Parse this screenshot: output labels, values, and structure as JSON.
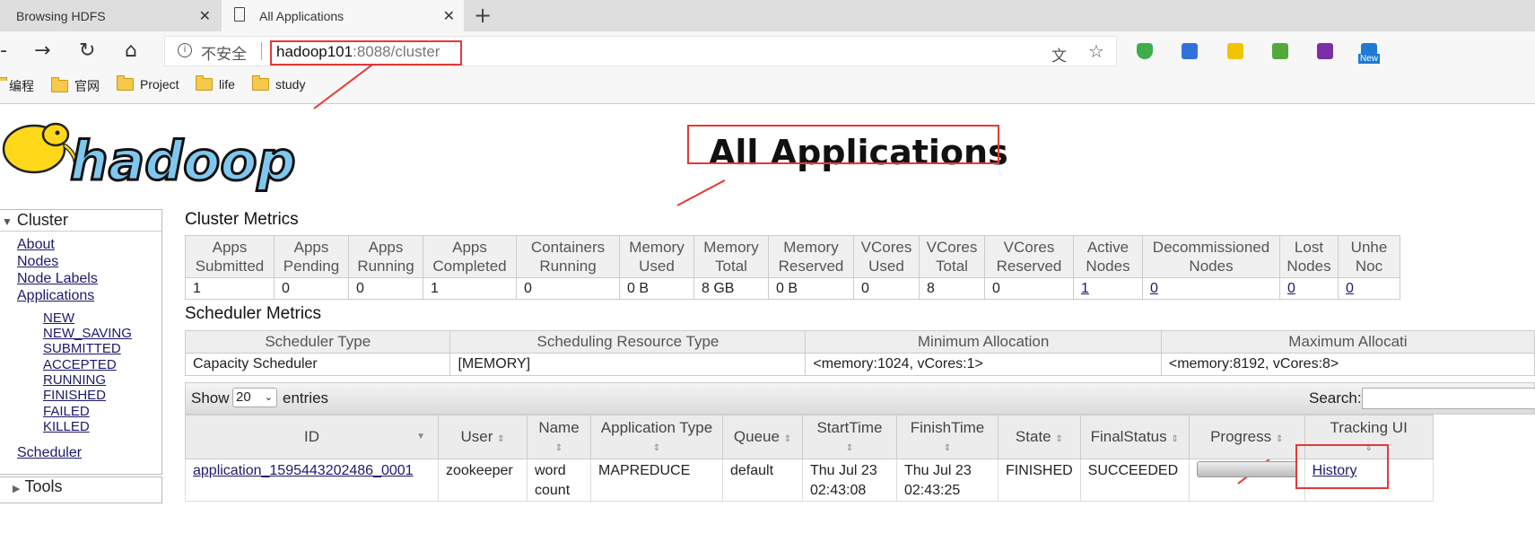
{
  "browser": {
    "tabs": [
      {
        "label": "Browsing HDFS",
        "active": false
      },
      {
        "label": "All Applications",
        "active": true
      }
    ],
    "address": {
      "security": "不安全",
      "host": "hadoop101",
      "path": ":8088/cluster"
    },
    "bookmarks": [
      "编程",
      "官网",
      "Project",
      "life",
      "study"
    ],
    "extension_badge": "New"
  },
  "page": {
    "title": "All Applications",
    "logo_text": "hadoop"
  },
  "sidebar": {
    "cluster_label": "Cluster",
    "links": [
      "About",
      "Nodes",
      "Node Labels",
      "Applications"
    ],
    "app_states": [
      "NEW",
      "NEW_SAVING",
      "SUBMITTED",
      "ACCEPTED",
      "RUNNING",
      "FINISHED",
      "FAILED",
      "KILLED"
    ],
    "scheduler": "Scheduler",
    "tools": "Tools"
  },
  "cluster_metrics": {
    "title": "Cluster Metrics",
    "headers": [
      [
        "Apps",
        "Submitted"
      ],
      [
        "Apps",
        "Pending"
      ],
      [
        "Apps",
        "Running"
      ],
      [
        "Apps",
        "Completed"
      ],
      [
        "Containers",
        "Running"
      ],
      [
        "Memory",
        "Used"
      ],
      [
        "Memory",
        "Total"
      ],
      [
        "Memory",
        "Reserved"
      ],
      [
        "VCores",
        "Used"
      ],
      [
        "VCores",
        "Total"
      ],
      [
        "VCores",
        "Reserved"
      ],
      [
        "Active",
        "Nodes"
      ],
      [
        "Decommissioned",
        "Nodes"
      ],
      [
        "Lost",
        "Nodes"
      ],
      [
        "Unhe",
        "Noc"
      ]
    ],
    "values": [
      "1",
      "0",
      "0",
      "1",
      "0",
      "0 B",
      "8 GB",
      "0 B",
      "0",
      "8",
      "0",
      "1",
      "0",
      "0",
      "0"
    ]
  },
  "scheduler_metrics": {
    "title": "Scheduler Metrics",
    "headers": [
      "Scheduler Type",
      "Scheduling Resource Type",
      "Minimum Allocation",
      "Maximum Allocati"
    ],
    "values": [
      "Capacity Scheduler",
      "[MEMORY]",
      "<memory:1024, vCores:1>",
      "<memory:8192, vCores:8>"
    ]
  },
  "apps_table": {
    "show_label": "Show",
    "page_size": "20",
    "entries_label": "entries",
    "search_label": "Search:",
    "headers": [
      "ID",
      "User",
      "Name",
      "Application Type",
      "Queue",
      "StartTime",
      "FinishTime",
      "State",
      "FinalStatus",
      "Progress",
      "Tracking UI"
    ],
    "row": {
      "id": "application_1595443202486_0001",
      "user": "zookeeper",
      "name": "word count",
      "type": "MAPREDUCE",
      "queue": "default",
      "start": "Thu Jul 23 02:43:08",
      "finish": "Thu Jul 23 02:43:25",
      "state": "FINISHED",
      "final_status": "SUCCEEDED",
      "progress": 1.0,
      "tracking": "History"
    }
  },
  "colors": {
    "annotation": "#e53935",
    "link": "#1a1a6e"
  }
}
